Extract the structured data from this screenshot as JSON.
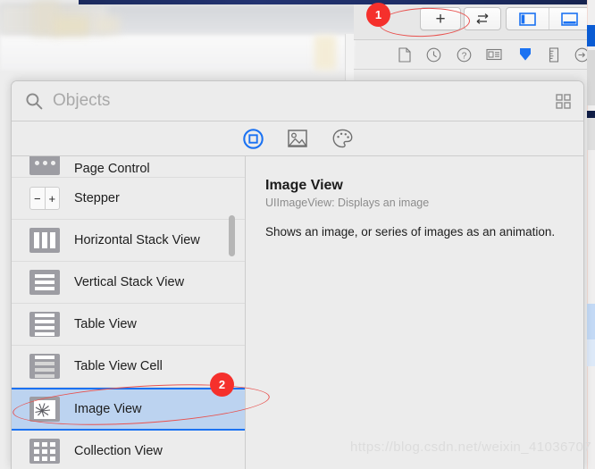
{
  "window": {
    "toolbar": {
      "add_button_label": "+",
      "add_button_icon": "plus-icon",
      "swap_button_icon": "left-right-arrow-icon",
      "swap_button_label": "↩→",
      "panel_toggle_left_icon": "left-panel-toggle-icon",
      "panel_toggle_bottom_icon": "bottom-panel-toggle-icon"
    },
    "inspector_tabs": [
      {
        "name": "file-inspector-icon",
        "selected": false
      },
      {
        "name": "quick-help-clock-icon",
        "selected": false
      },
      {
        "name": "help-inspector-icon",
        "selected": false
      },
      {
        "name": "identity-inspector-icon",
        "selected": false
      },
      {
        "name": "attributes-inspector-icon",
        "selected": true
      },
      {
        "name": "size-inspector-ruler-icon",
        "selected": false
      },
      {
        "name": "connections-inspector-icon",
        "selected": false
      }
    ]
  },
  "library_popover": {
    "search": {
      "icon": "search-icon",
      "placeholder": "Objects",
      "value": "",
      "grid_view_icon": "grid-view-icon"
    },
    "segment_tabs": [
      {
        "name": "objects-library-tab",
        "icon": "rounded-square-icon",
        "selected": true
      },
      {
        "name": "media-library-tab",
        "icon": "image-icon",
        "selected": false
      },
      {
        "name": "color-library-tab",
        "icon": "color-palette-icon",
        "selected": false
      }
    ],
    "items": [
      {
        "label": "Page Control",
        "icon": "page-control-icon",
        "selected": false,
        "partial": true
      },
      {
        "label": "Stepper",
        "icon": "stepper-icon",
        "selected": false,
        "partial": false
      },
      {
        "label": "Horizontal Stack View",
        "icon": "horizontal-stack-icon",
        "selected": false,
        "partial": false
      },
      {
        "label": "Vertical Stack View",
        "icon": "vertical-stack-icon",
        "selected": false,
        "partial": false
      },
      {
        "label": "Table View",
        "icon": "table-view-icon",
        "selected": false,
        "partial": false
      },
      {
        "label": "Table View Cell",
        "icon": "table-view-cell-icon",
        "selected": false,
        "partial": false
      },
      {
        "label": "Image View",
        "icon": "image-view-icon",
        "selected": true,
        "partial": false
      },
      {
        "label": "Collection View",
        "icon": "collection-view-icon",
        "selected": false,
        "partial": false
      }
    ],
    "detail": {
      "title": "Image View",
      "subtitle": "UIImageView: Displays an image",
      "description": "Shows an image, or series of images as an animation."
    }
  },
  "annotations": [
    {
      "name": "annotation-badge-1",
      "label": "1",
      "target": "add-button"
    },
    {
      "name": "annotation-badge-2",
      "label": "2",
      "target": "image-view-row"
    }
  ],
  "watermark": {
    "text": "https://blog.csdn.net/weixin_41036707"
  },
  "colors": {
    "accent_blue": "#1b72f2",
    "selection_blue": "#bcd3f0",
    "annotation_red": "#f5302c",
    "chrome_gray": "#ececec"
  }
}
